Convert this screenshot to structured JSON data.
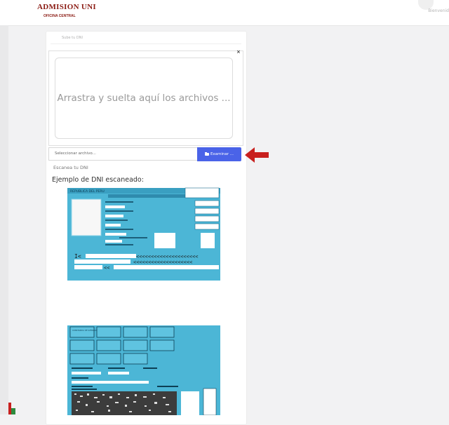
{
  "header": {
    "brand_title": "ADMISION UNI",
    "brand_subtitle": "OFICINA CENTRAL",
    "welcome_text": "Bienvenid"
  },
  "upload": {
    "tab_label": "Sube tu DNI",
    "close_symbol": "×",
    "dropzone_text": "Arrastra y suelta aquí los archivos ...",
    "file_placeholder": "Seleccionar archivo...",
    "browse_label": "Examinar ...",
    "scan_label": "Escanea tu DNI"
  },
  "example": {
    "title": "Ejemplo de DNI escaneado:",
    "front_header": "REPUBLICA DEL PERU",
    "back_vote_label": "CONSTANCIA DE SUFRAGIO",
    "mrz_line_1": "I<",
    "mrz_line_3": "<<"
  },
  "colors": {
    "brand": "#8a1a12",
    "button": "#4a63e8",
    "arrow": "#c8201e",
    "card_blue": "#4cb6d6"
  }
}
